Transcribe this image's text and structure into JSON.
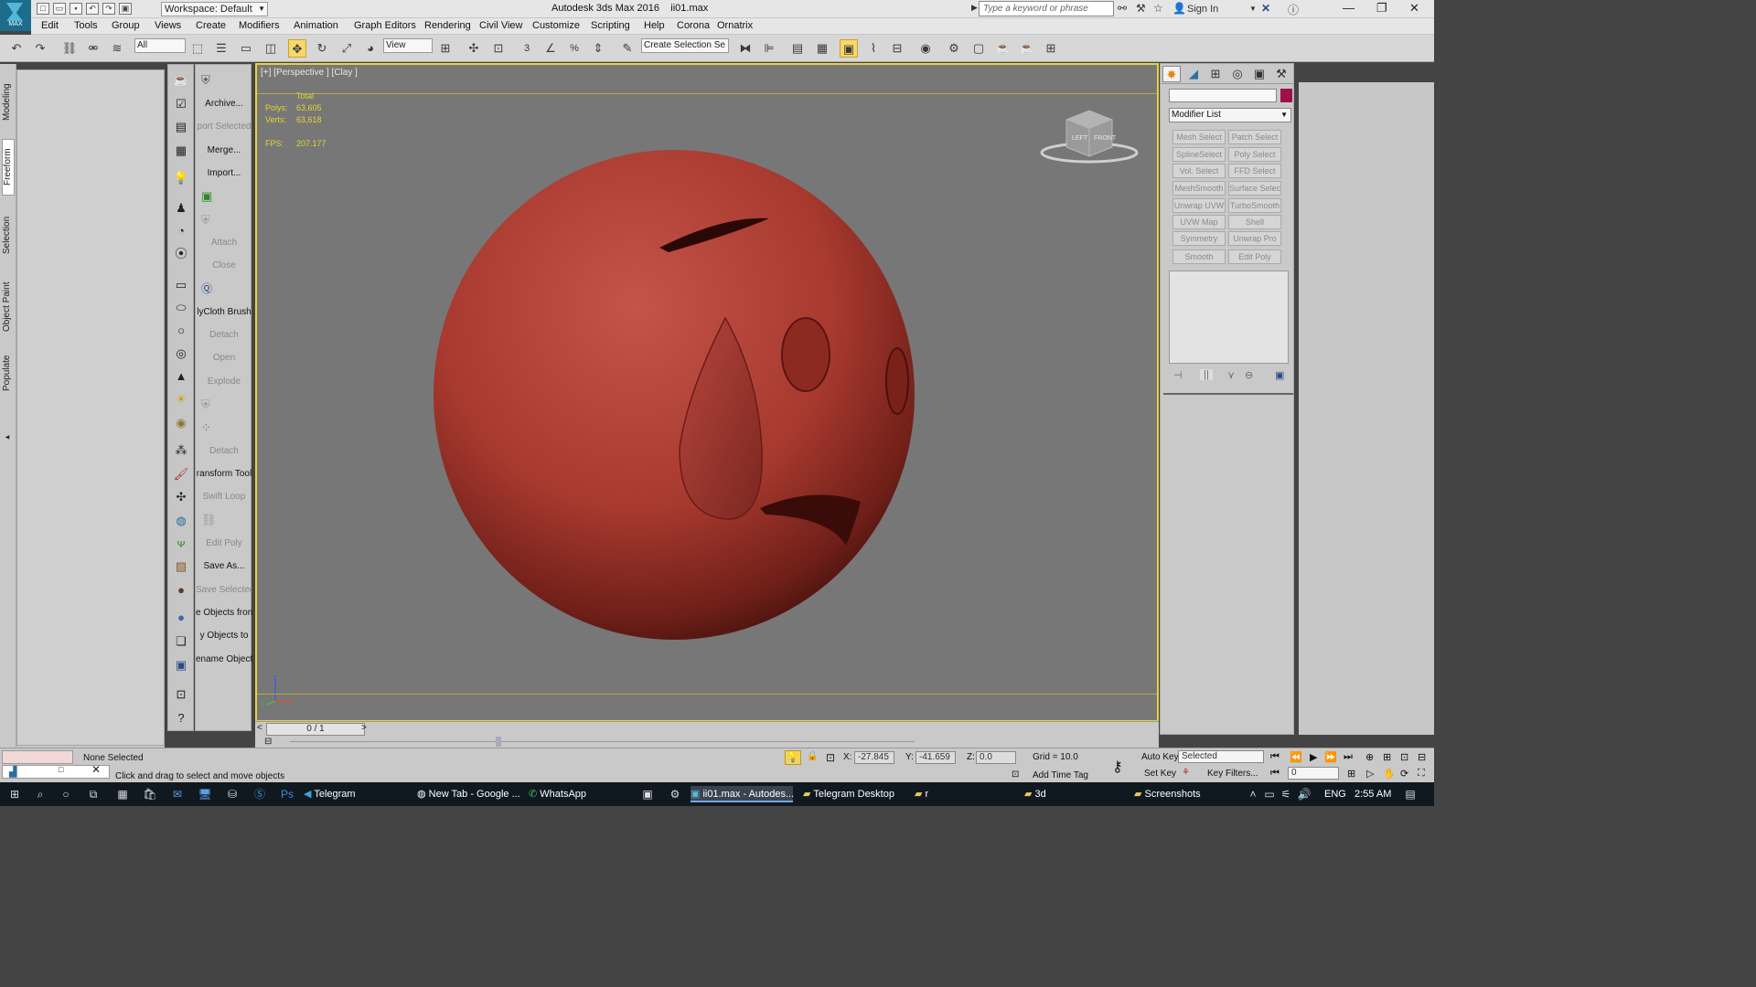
{
  "titlebar": {
    "app_title": "Autodesk 3ds Max 2016",
    "file_name": "ii01.max",
    "workspace": "Workspace: Default",
    "search_placeholder": "Type a keyword or phrase",
    "sign_in": "Sign In"
  },
  "logo_text": "MAX",
  "menu": [
    "Edit",
    "Tools",
    "Group",
    "Views",
    "Create",
    "Modifiers",
    "Animation",
    "Graph Editors",
    "Rendering",
    "Civil View",
    "Customize",
    "Scripting",
    "Help",
    "Corona",
    "Ornatrix"
  ],
  "toolbar": {
    "filter": "All",
    "reference": "View",
    "selection_set": "Create Selection Se",
    "snap_labels": [
      "3",
      "%"
    ]
  },
  "ribbon_tabs": [
    "Modeling",
    "Freeform",
    "Selection",
    "Object Paint",
    "Populate"
  ],
  "tool_buttons": [
    "Archive...",
    "port Selected",
    "Merge...",
    "Import...",
    "Attach",
    "Close",
    "lyCloth Brush",
    "Detach",
    "Open",
    "Explode",
    "Detach",
    "ransform Tool",
    "Swift Loop",
    "Edit Poly",
    "Save As...",
    "Save Selected",
    "e Objects fron",
    "y Objects to",
    "ename Objects"
  ],
  "viewport": {
    "label": "[+] [Perspective ] [Clay ]",
    "stats": {
      "total_label": "Total",
      "polys_label": "Polys:",
      "polys": "63,605",
      "verts_label": "Verts:",
      "verts": "63,618",
      "fps_label": "FPS:",
      "fps": "207.177"
    },
    "viewcube_faces": [
      "LEFT",
      "FRONT"
    ],
    "axis_labels": [
      "z",
      "y",
      "x"
    ]
  },
  "command_panel": {
    "modifier_list": "Modifier List",
    "modifiers": [
      "Mesh Select",
      "Patch Select",
      "SplineSelect",
      "Poly Select",
      "Vol. Select",
      "FFD Select",
      "MeshSmooth",
      "Surface Select",
      "Unwrap UVW",
      "TurboSmooth",
      "UVW Map",
      "Shell",
      "Symmetry",
      "Unwrap Pro",
      "Smooth",
      "Edit Poly"
    ],
    "object_color": "#a01047"
  },
  "timeline": {
    "position": "0 / 1"
  },
  "status": {
    "selection": "None Selected",
    "prompt": "Click and drag to select and move objects",
    "x_label": "X:",
    "x": "-27.845",
    "y_label": "Y:",
    "y": "-41.659",
    "z_label": "Z:",
    "z": "0.0",
    "grid": "Grid = 10.0",
    "add_time_tag": "Add Time Tag",
    "auto_key": "Auto Key",
    "set_key": "Set Key",
    "key_mode": "Selected",
    "key_filters": "Key Filters...",
    "frame": "0"
  },
  "taskbar": {
    "items": [
      "Telegram",
      "New Tab - Google ...",
      "WhatsApp",
      "ii01.max - Autodes...",
      "Telegram Desktop",
      "r",
      "3d",
      "Screenshots"
    ],
    "lang": "ENG",
    "time": "2:55 AM"
  },
  "colors": {
    "viewport_border": "#e6d23a",
    "sphere": "#b8453b",
    "stats": "#e5d532",
    "taskbar": "#101820"
  }
}
